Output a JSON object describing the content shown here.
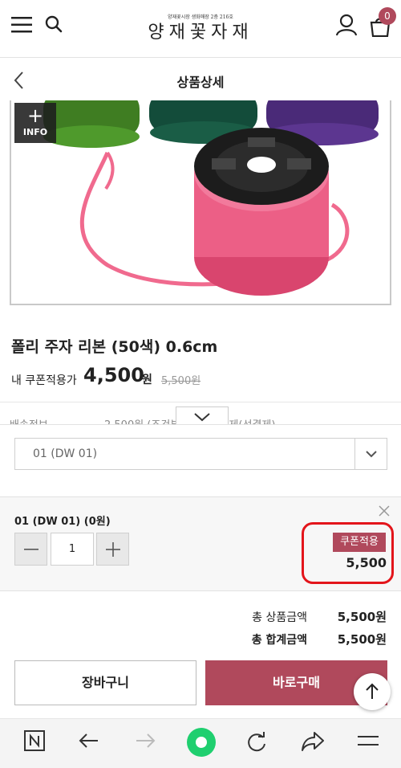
{
  "header": {
    "logo_small": "양재꽃시장 생화매장 2층 216호",
    "logo_main": "양재꽃자재",
    "cart_count": "0"
  },
  "titlebar": {
    "title": "상품상세"
  },
  "product_image": {
    "info_label": "INFO"
  },
  "product": {
    "name": "폴리 주자 리본 (50색) 0.6cm",
    "coupon_price_label": "내 쿠폰적용가",
    "sale_price": "4,500",
    "sale_unit": "원",
    "original_price": "5,500원",
    "shipping_label": "배송정보",
    "shipping_text": "2,500원 (조건부 무료) 선결제(선결제)"
  },
  "option_select": {
    "selected": "01 (DW 01)"
  },
  "selected_option": {
    "name": "01 (DW 01) (0원)",
    "quantity": "1",
    "coupon_badge": "쿠폰적용",
    "price": "5,500"
  },
  "totals": {
    "product_total_label": "총 상품금액",
    "product_total_value": "5,500원",
    "grand_total_label": "총 합계금액",
    "grand_total_value": "5,500원"
  },
  "actions": {
    "cart": "장바구니",
    "buy": "바로구매"
  },
  "colors": {
    "accent": "#b0495c",
    "highlight_circle": "#e3151b",
    "browser_green": "#1fcf6f"
  }
}
